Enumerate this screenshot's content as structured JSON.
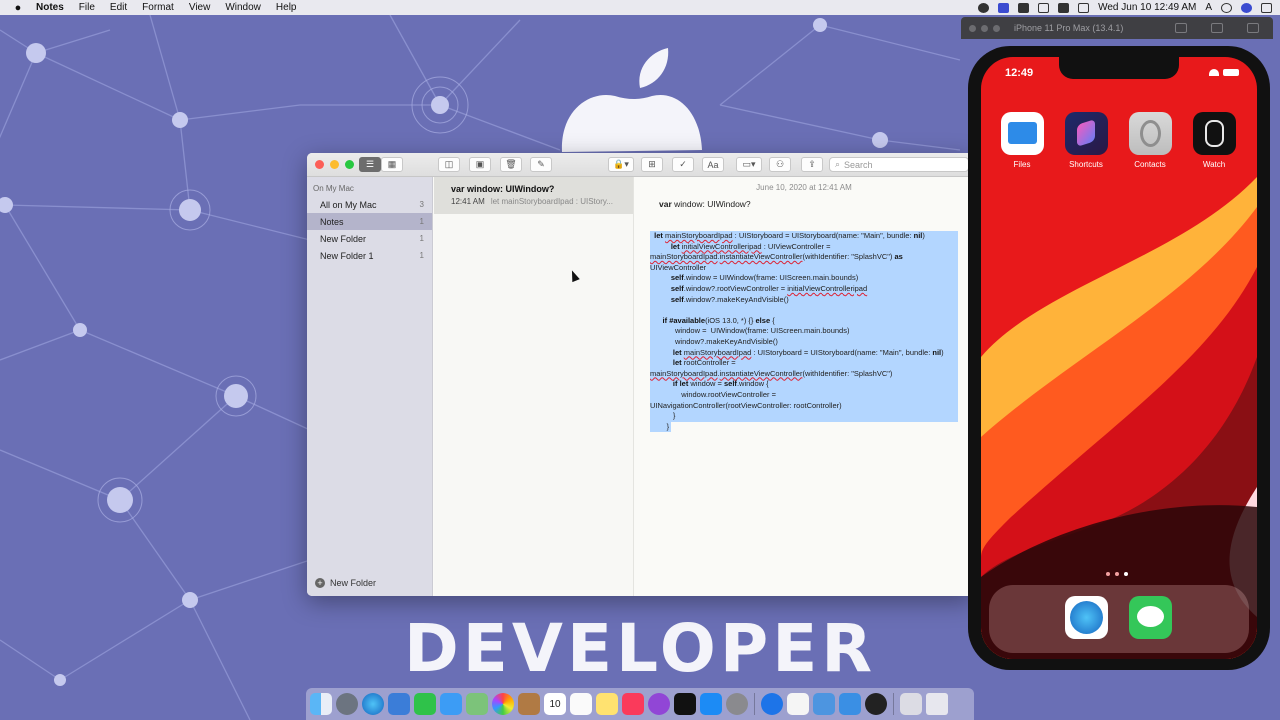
{
  "menubar": {
    "apple": "",
    "items": [
      "Notes",
      "File",
      "Edit",
      "Format",
      "View",
      "Window",
      "Help"
    ],
    "clock": "Wed Jun 10  12:49 AM",
    "input_indicator": "A"
  },
  "desktop": {
    "banner_text": "DEVELOPER"
  },
  "notes_window": {
    "search_placeholder": "Search",
    "sidebar": {
      "section_header": "On My Mac",
      "folders": [
        {
          "label": "All on My Mac",
          "count": "3"
        },
        {
          "label": "Notes",
          "count": "1"
        },
        {
          "label": "New Folder",
          "count": "1"
        },
        {
          "label": "New Folder 1",
          "count": "1"
        }
      ],
      "new_folder_label": "New Folder"
    },
    "note_list": [
      {
        "title": "var window: UIWindow?",
        "time": "12:41 AM",
        "snippet": "let mainStoryboardIpad : UIStory..."
      }
    ],
    "editor": {
      "date": "June 10, 2020 at 12:41 AM",
      "title_keyword": "var",
      "title_rest": " window: UIWindow?"
    }
  },
  "simulator": {
    "title": "iPhone 11 Pro Max (13.4.1)",
    "status_time": "12:49",
    "apps": [
      {
        "label": "Files",
        "icon": "files-icon"
      },
      {
        "label": "Shortcuts",
        "icon": "shortcuts-icon"
      },
      {
        "label": "Contacts",
        "icon": "contacts-icon"
      },
      {
        "label": "Watch",
        "icon": "watch-icon"
      }
    ],
    "dock_apps": [
      {
        "label": "Safari",
        "icon": "safari-icon"
      },
      {
        "label": "Messages",
        "icon": "messages-icon"
      }
    ]
  },
  "mac_dock": {
    "calendar_day": "10",
    "apps": [
      "finder",
      "launchpad",
      "safari",
      "preview",
      "facetime",
      "mail",
      "maps",
      "photos",
      "contacts",
      "calendar",
      "reminders",
      "notes",
      "music",
      "podcasts",
      "tv",
      "app-store",
      "system-preferences",
      "teamviewer",
      "textedit",
      "xcode-folder",
      "simulator",
      "quicktime",
      "downloads",
      "trash"
    ]
  },
  "colors": {
    "desktop_bg": "#6a6fb5",
    "selection": "#b3d6ff",
    "iphone_wallpaper": "#e8191b"
  }
}
